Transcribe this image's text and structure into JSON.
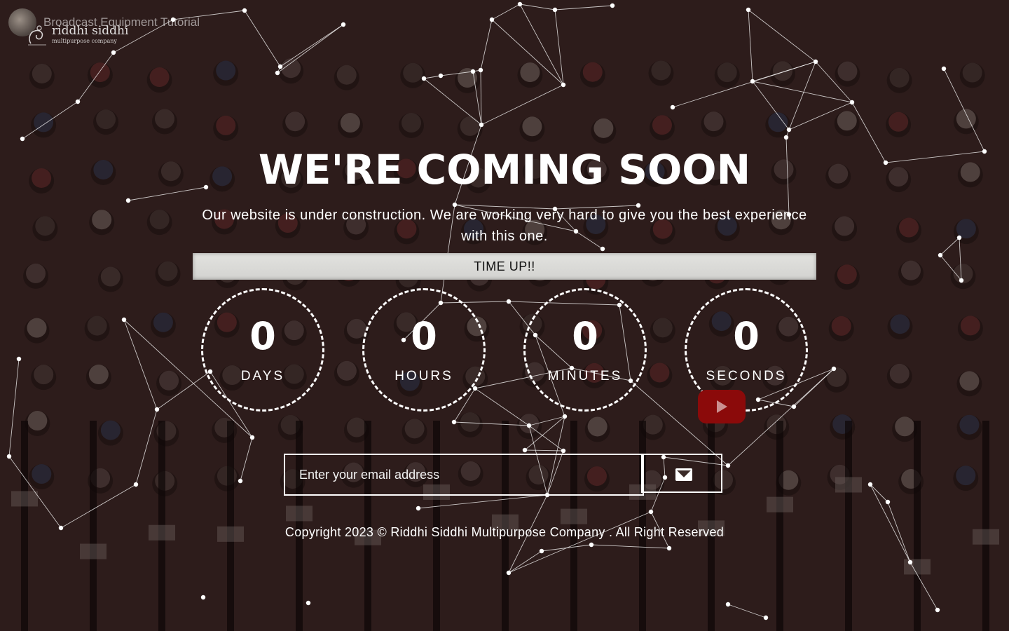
{
  "video": {
    "title": "Broadcast Equipment Tutorial",
    "thumb_icon": "channel-avatar"
  },
  "logo": {
    "name": "riddhi siddhi",
    "tagline": "multipurpose company"
  },
  "hero": {
    "title": "WE'RE COMING SOON",
    "subtitle": "Our website is under construction. We are working very hard to give you the best experience with this one.",
    "status": "TIME UP!!"
  },
  "countdown": [
    {
      "value": "0",
      "label": "DAYS"
    },
    {
      "value": "0",
      "label": "HOURS"
    },
    {
      "value": "0",
      "label": "MINUTES"
    },
    {
      "value": "0",
      "label": "SECONDS"
    }
  ],
  "youtube": {
    "icon": "youtube-play-icon",
    "color": "#8b0a0a"
  },
  "subscribe": {
    "placeholder": "Enter your email address",
    "value": "",
    "submit_icon": "envelope-icon"
  },
  "footer": {
    "copyright": "Copyright 2023 © Riddhi Siddhi Multipurpose Company . All Right Reserved"
  },
  "colors": {
    "text": "#ffffff",
    "status_bar": "#d8d8d5",
    "youtube_red": "#8b0a0a"
  }
}
